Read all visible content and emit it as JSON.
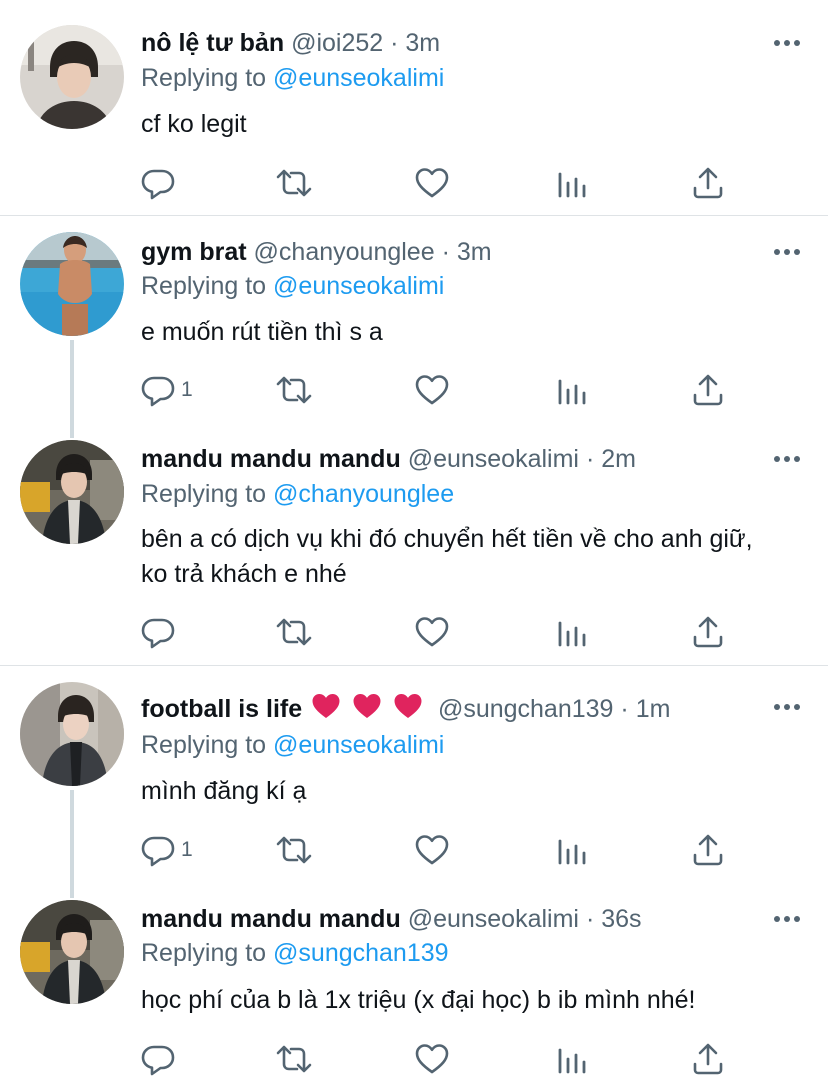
{
  "tweets": [
    {
      "name": "nô lệ tư bản",
      "handle": "@ioi252",
      "dot": "·",
      "time": "3m",
      "replying_label": "Replying to",
      "replying_to": "@eunseokalimi",
      "text": "cf ko legit",
      "reply_count": ""
    },
    {
      "name": "gym brat",
      "handle": "@chanyounglee",
      "dot": "·",
      "time": "3m",
      "replying_label": "Replying to",
      "replying_to": "@eunseokalimi",
      "text": "e muốn rút tiền thì s a",
      "reply_count": "1"
    },
    {
      "name": "mandu mandu mandu",
      "handle": "@eunseokalimi",
      "dot": "·",
      "time": "2m",
      "replying_label": "Replying to",
      "replying_to": "@chanyounglee",
      "text": "bên a có dịch vụ khi đó chuyển hết tiền về cho anh giữ, ko trả khách e nhé",
      "reply_count": ""
    },
    {
      "name": "football is life",
      "handle": "@sungchan139",
      "dot": "·",
      "time": "1m",
      "replying_label": "Replying to",
      "replying_to": "@eunseokalimi",
      "text": "mình đăng kí ạ",
      "reply_count": "1",
      "name_emoji": "heart-emoji x3"
    },
    {
      "name": "mandu mandu mandu",
      "handle": "@eunseokalimi",
      "dot": "·",
      "time": "36s",
      "replying_label": "Replying to",
      "replying_to": "@sungchan139",
      "text": "học phí của b là 1x triệu (x đại học) b ib mình nhé!",
      "reply_count": ""
    }
  ],
  "icons": {
    "reply": "reply-bubble-icon",
    "retweet": "retweet-icon",
    "like": "heart-icon",
    "views": "analytics-icon",
    "share": "share-icon",
    "more": "more-dots-icon"
  },
  "colors": {
    "text": "#0f1419",
    "secondary": "#536471",
    "link": "#1d9bf0",
    "divider": "#dfe3e6",
    "heart_emoji": "#e0245e"
  }
}
